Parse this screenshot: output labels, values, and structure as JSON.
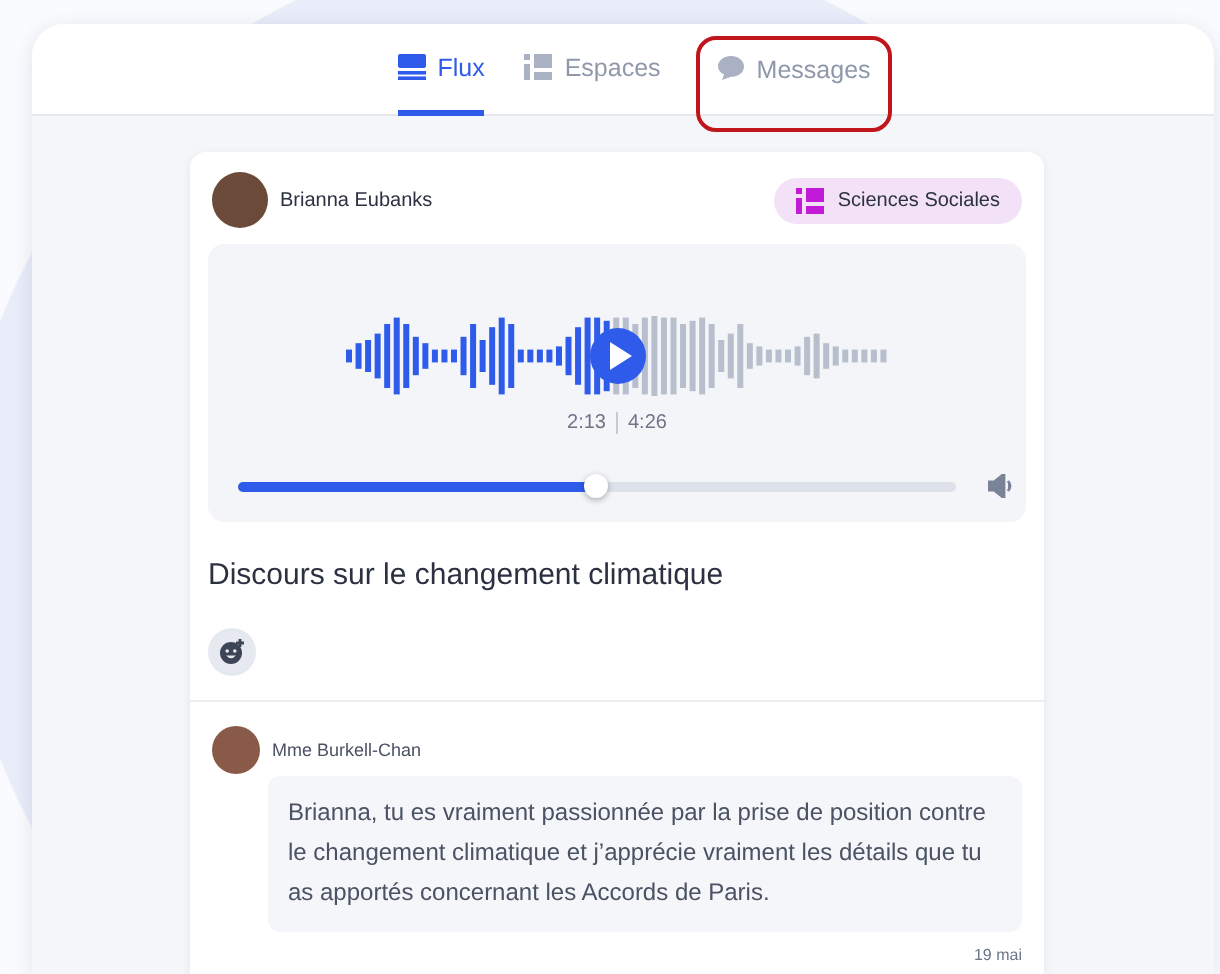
{
  "tabs": [
    {
      "label": "Flux",
      "kind": "feed",
      "selected": true,
      "highlighted": false
    },
    {
      "label": "Espaces",
      "kind": "spaces",
      "selected": false,
      "highlighted": false
    },
    {
      "label": "Messages",
      "kind": "messages",
      "selected": false,
      "highlighted": true
    }
  ],
  "post": {
    "author": "Brianna Eubanks",
    "space": "Sciences Sociales",
    "audio": {
      "elapsed": "2:13",
      "duration": "4:26",
      "level": 0.5
    },
    "title": "Discours sur le changement climatique"
  },
  "comments": [
    {
      "author": "Mme Burkell-Chan",
      "text": "Brianna, tu es vraiment passionnée par la prise de position contre le changement climatique et j’apprécie vraiment les détails que tu as apportés concernant les Accords de Paris.",
      "date": "19 mai"
    }
  ]
}
